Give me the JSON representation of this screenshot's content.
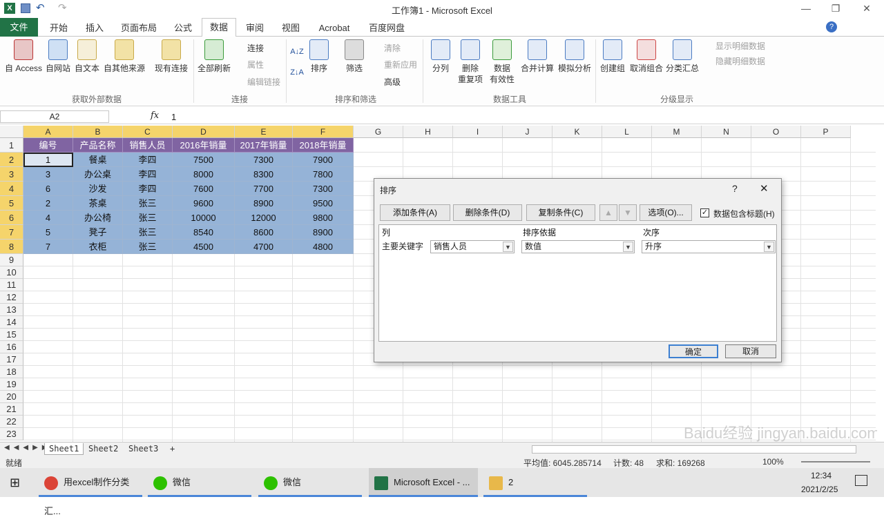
{
  "window": {
    "title": "工作簿1 - Microsoft Excel"
  },
  "tabs": [
    "文件",
    "开始",
    "插入",
    "页面布局",
    "公式",
    "数据",
    "审阅",
    "视图",
    "Acrobat",
    "百度网盘"
  ],
  "ribbon": {
    "ext": [
      "自 Access",
      "自网站",
      "自文本",
      "自其他来源",
      "现有连接"
    ],
    "refresh": "全部刷新",
    "conn": [
      "连接",
      "属性",
      "编辑链接"
    ],
    "sort": "排序",
    "filter": "筛选",
    "filter_opts": [
      "清除",
      "重新应用",
      "高级"
    ],
    "tools": [
      "分列",
      "删除",
      "重复项",
      "数据",
      "有效性",
      "合并计算",
      "模拟分析"
    ],
    "outline": [
      "创建组",
      "取消组合",
      "分类汇总"
    ],
    "outline_opts": [
      "显示明细数据",
      "隐藏明细数据"
    ],
    "groups": [
      "获取外部数据",
      "连接",
      "排序和筛选",
      "数据工具",
      "分级显示"
    ]
  },
  "formula": {
    "namebox": "A2",
    "fx": "fx",
    "value": "1"
  },
  "columns": [
    "A",
    "B",
    "C",
    "D",
    "E",
    "F",
    "G",
    "H",
    "I",
    "J",
    "K",
    "L",
    "M",
    "N",
    "O",
    "P"
  ],
  "rows": [
    "1",
    "2",
    "3",
    "4",
    "5",
    "6",
    "7",
    "8",
    "9",
    "10",
    "11",
    "12",
    "13",
    "14",
    "15",
    "16",
    "17",
    "18",
    "19",
    "20",
    "21",
    "22",
    "23"
  ],
  "table": {
    "headers": [
      "编号",
      "产品名称",
      "销售人员",
      "2016年销量",
      "2017年销量",
      "2018年销量"
    ],
    "rows": [
      [
        "1",
        "餐桌",
        "李四",
        "7500",
        "7300",
        "7900"
      ],
      [
        "3",
        "办公桌",
        "李四",
        "8000",
        "8300",
        "7800"
      ],
      [
        "6",
        "沙发",
        "李四",
        "7600",
        "7700",
        "7300"
      ],
      [
        "2",
        "茶桌",
        "张三",
        "9600",
        "8900",
        "9500"
      ],
      [
        "4",
        "办公椅",
        "张三",
        "10000",
        "12000",
        "9800"
      ],
      [
        "5",
        "凳子",
        "张三",
        "8540",
        "8600",
        "8900"
      ],
      [
        "7",
        "衣柜",
        "张三",
        "4500",
        "4700",
        "4800"
      ]
    ]
  },
  "dialog": {
    "title": "排序",
    "help": "?",
    "close": "✕",
    "add": "添加条件(A)",
    "del": "删除条件(D)",
    "copy": "复制条件(C)",
    "options": "选项(O)...",
    "header_check": "数据包含标题(H)",
    "col_hdr": "列",
    "basis_hdr": "排序依据",
    "order_hdr": "次序",
    "key_label": "主要关键字",
    "key_value": "销售人员",
    "basis_value": "数值",
    "order_value": "升序",
    "ok": "确定",
    "cancel": "取消"
  },
  "sheets": [
    "Sheet1",
    "Sheet2",
    "Sheet3"
  ],
  "status": {
    "ready": "就绪",
    "avg": "平均值: 6045.285714",
    "count": "计数: 48",
    "sum": "求和: 169268",
    "zoom": "100%"
  },
  "taskbar": {
    "items": [
      "用excel制作分类汇...",
      "微信",
      "微信",
      "Microsoft Excel - ...",
      "2"
    ],
    "time": "12:34",
    "date": "2021/2/25"
  },
  "watermark": "Baidu经验 jingyan.baidu.com",
  "colors": {
    "header": "#8064a2",
    "data": "#95b3d7",
    "file": "#217346",
    "selected": "#f5d46b"
  }
}
